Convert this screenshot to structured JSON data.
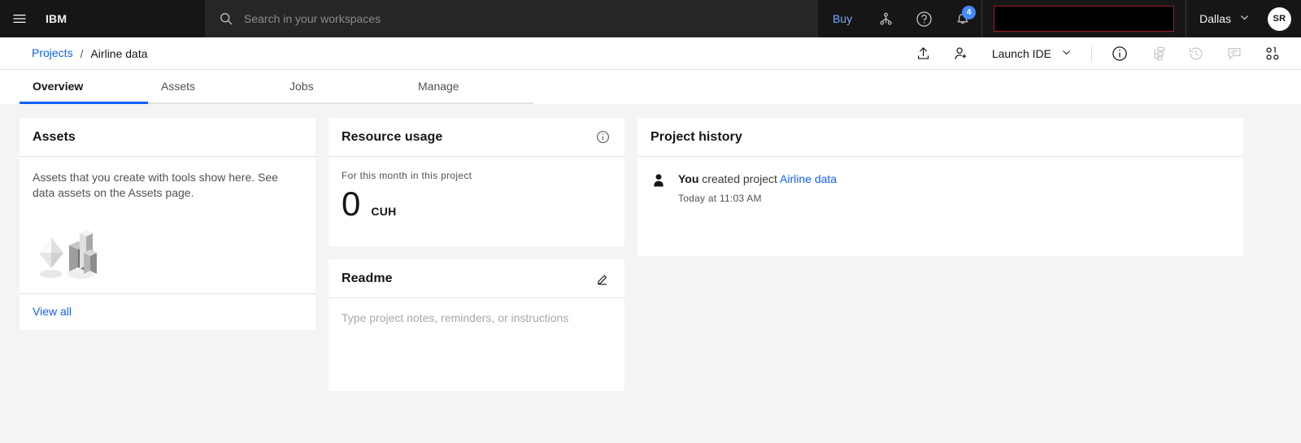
{
  "header": {
    "menu_icon": "hamburger-menu-icon",
    "brand": "IBM",
    "search": {
      "icon": "search-icon",
      "placeholder": "Search in your workspaces",
      "value": ""
    },
    "buy_label": "Buy",
    "icons": [
      {
        "name": "app-switcher-icon",
        "glyph": "app-switcher"
      },
      {
        "name": "help-icon",
        "glyph": "question-circle"
      },
      {
        "name": "notifications-icon",
        "glyph": "bell",
        "badge": "4"
      }
    ],
    "redacted_field": {
      "name": "redacted-account-field",
      "value": "",
      "border_color": "#a2191f",
      "fill_color": "#000000"
    },
    "region": {
      "label": "Dallas",
      "chevron": "chevron-down-icon"
    },
    "avatar": {
      "initials": "SR"
    }
  },
  "breadcrumb": {
    "parent": "Projects",
    "separator": "/",
    "current": "Airline data",
    "actions": {
      "upload": "upload-icon",
      "add_collaborator": "add-user-icon",
      "launch_ide": {
        "label": "Launch IDE",
        "chevron": "chevron-down-icon"
      },
      "info": "information-icon",
      "lineage": "tree-view-icon",
      "history": "recently-viewed-icon",
      "comments": "comment-icon",
      "data_class": "data-class-icon"
    }
  },
  "tabs": [
    {
      "label": "Overview",
      "active": true
    },
    {
      "label": "Assets",
      "active": false
    },
    {
      "label": "Jobs",
      "active": false
    },
    {
      "label": "Manage",
      "active": false
    }
  ],
  "assets_card": {
    "title": "Assets",
    "body_text": "Assets that you create with tools show here. See data assets on the Assets page.",
    "illustration": "empty-assets-illustration",
    "footer_link": "View all"
  },
  "resource_usage_card": {
    "title": "Resource usage",
    "info_icon": "information-icon",
    "period_label": "For this month in this project",
    "value": "0",
    "unit": "CUH"
  },
  "readme_card": {
    "title": "Readme",
    "edit_icon": "edit-pencil-icon",
    "placeholder": "Type project notes, reminders, or instructions",
    "value": ""
  },
  "project_history_card": {
    "title": "Project history",
    "entries": [
      {
        "avatar_icon": "user-avatar-icon",
        "actor": "You",
        "action": "created project",
        "target": "Airline data",
        "timestamp": "Today at 11:03 AM"
      }
    ]
  },
  "colors": {
    "header_bg": "#161616",
    "search_bg": "#262626",
    "page_bg": "#f4f4f4",
    "card_bg": "#ffffff",
    "link_blue": "#0f62fe",
    "header_link_blue": "#78a9ff",
    "badge_blue": "#4589ff",
    "border": "#e0e0e0",
    "redaction_border": "#a2191f"
  }
}
